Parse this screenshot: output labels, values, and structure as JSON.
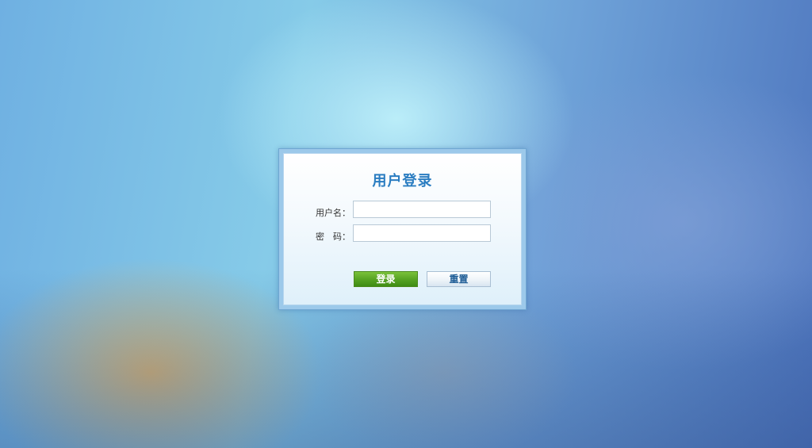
{
  "login": {
    "title": "用户登录",
    "username_label": "用户名：",
    "password_label": "密　码：",
    "username_value": "",
    "password_value": "",
    "login_button": "登录",
    "reset_button": "重置"
  },
  "colors": {
    "title": "#2b7dc1",
    "login_button": "#58a423",
    "frame_border": "#6fa6d2"
  }
}
